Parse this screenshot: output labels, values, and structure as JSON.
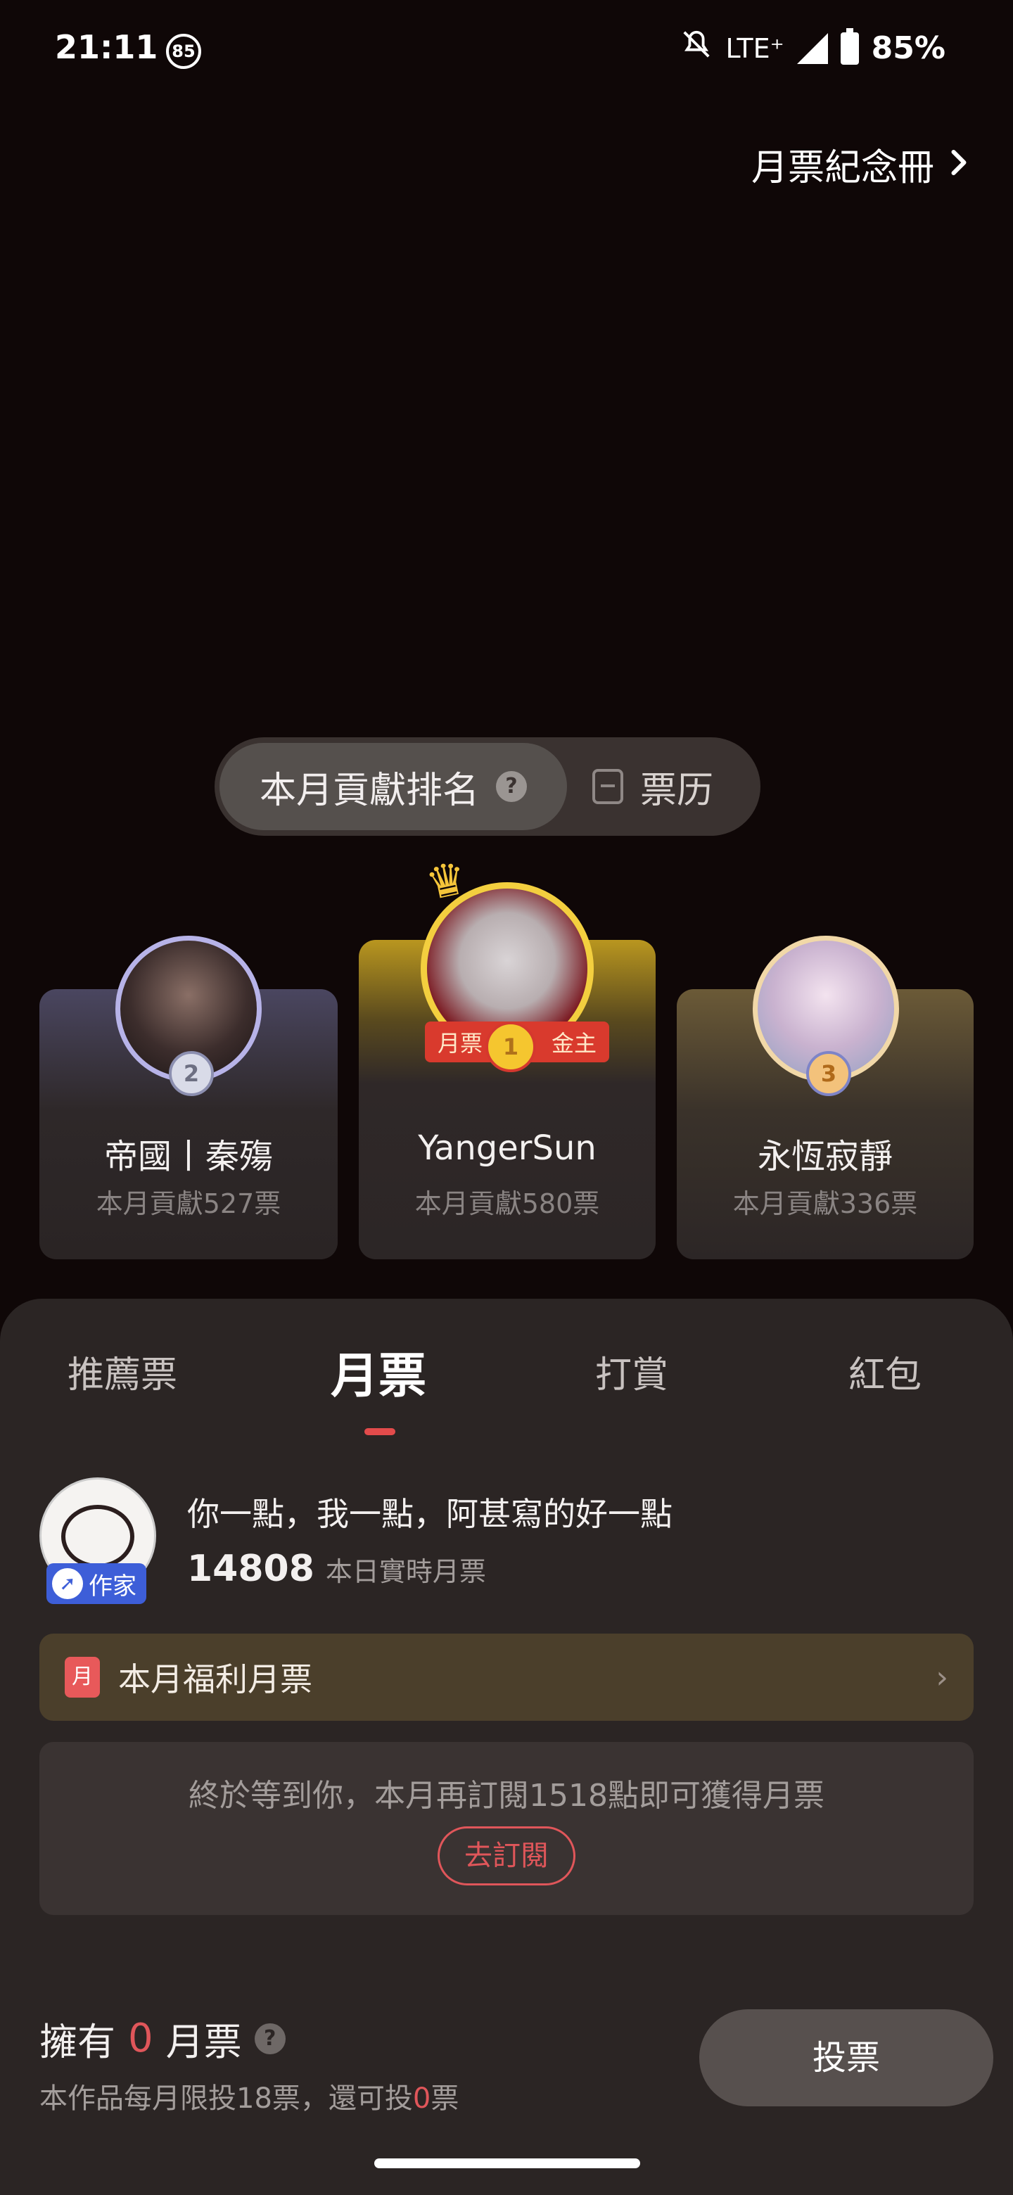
{
  "status_bar": {
    "time": "21:11",
    "notification_count": "85",
    "network": "LTE⁺",
    "battery": "85%",
    "icons": [
      "bell-off-icon",
      "signal-icon",
      "battery-icon"
    ]
  },
  "header": {
    "album_link": "月票紀念冊"
  },
  "ranking_tabs": {
    "active": "本月貢獻排名",
    "other": "票历"
  },
  "podium": [
    {
      "rank": "2",
      "name": "帝國丨秦殤",
      "contribution": "本月貢獻527票"
    },
    {
      "rank": "1",
      "name": "YangerSun",
      "contribution": "本月貢獻580票",
      "ribbon_left": "月票",
      "ribbon_right": "金主"
    },
    {
      "rank": "3",
      "name": "永恆寂靜",
      "contribution": "本月貢獻336票"
    }
  ],
  "sheet": {
    "tabs": [
      "推薦票",
      "月票",
      "打賞",
      "紅包"
    ],
    "active_tab": "月票",
    "author": {
      "badge": "作家",
      "slogan": "你一點，我一點，阿甚寫的好一點",
      "realtime_count": "14808",
      "realtime_label": "本日實時月票"
    },
    "welfare": {
      "icon_text": "月",
      "label": "本月福利月票"
    },
    "subscribe": {
      "message": "終於等到你，本月再訂閱1518點即可獲得月票",
      "button": "去訂閱"
    },
    "owned": {
      "prefix": "擁有",
      "count": "0",
      "suffix": "月票",
      "limit_prefix": "本作品每月限投18票，還可投",
      "limit_remaining": "0",
      "limit_suffix": "票"
    },
    "vote_button": "投票"
  },
  "colors": {
    "accent_red": "#e0565a",
    "gold": "#f3cf3f",
    "background": "#0f0707",
    "sheet": "#2b2524"
  }
}
